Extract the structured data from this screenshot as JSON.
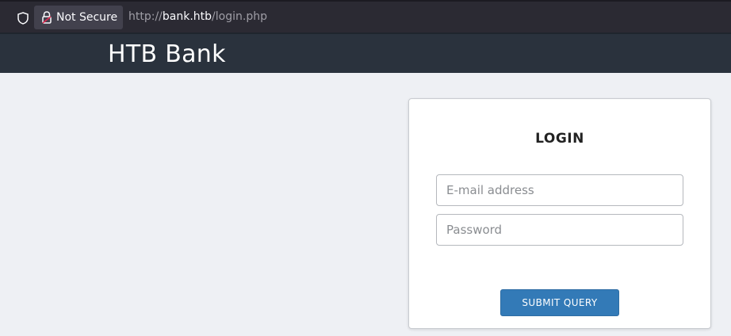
{
  "browser": {
    "security_label": "Not Secure",
    "url_prefix": "http://",
    "url_host": "bank.htb",
    "url_path": "/login.php",
    "icons": [
      "shield-icon",
      "lock-icon"
    ]
  },
  "site": {
    "brand": "HTB Bank"
  },
  "login": {
    "title": "LOGIN",
    "email_placeholder": "E-mail address",
    "email_value": "",
    "password_placeholder": "Password",
    "password_value": "",
    "submit_label": "SUBMIT QUERY"
  },
  "colors": {
    "navbar": "#2a323d",
    "page_bg": "#eef0f4",
    "submit_button": "#337ab7"
  }
}
